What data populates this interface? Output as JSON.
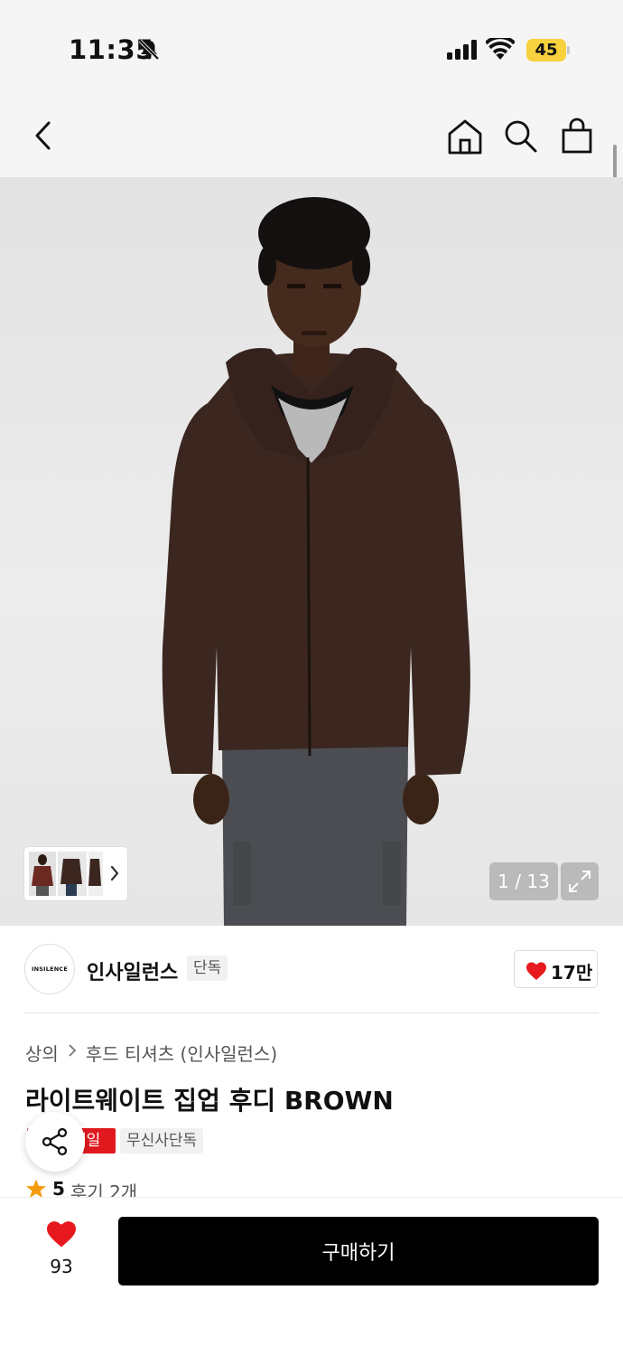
{
  "status_bar": {
    "time": "11:35",
    "battery": "45"
  },
  "navigation": {
    "back_icon": "chevron-left-icon",
    "home_icon": "home-icon",
    "search_icon": "search-icon",
    "bag_icon": "shopping-bag-icon"
  },
  "gallery": {
    "counter": "1 / 13",
    "expand_icon": "expand-icon",
    "thumbnail_next_icon": "chevron-right-icon"
  },
  "brand": {
    "logo_text": "INSILENCE",
    "name": "인사일런스",
    "tag": "단독",
    "likes": "17만"
  },
  "product": {
    "breadcrumb": [
      "상의",
      "후드 티셔츠 (인사일런스)"
    ],
    "title": "라이트웨이트 집업 후디 BROWN",
    "badges": {
      "sale": "세일",
      "exclusive": "무신사단독"
    },
    "rating_score": "5",
    "reviews": "후기 2개"
  },
  "bottom_bar": {
    "wishlist_count": "93",
    "buy_label": "구매하기"
  },
  "colors": {
    "sale_red": "#e0191e",
    "heart_red": "#e8191e",
    "battery_yellow": "#f7d23e",
    "button_black": "#000000"
  }
}
